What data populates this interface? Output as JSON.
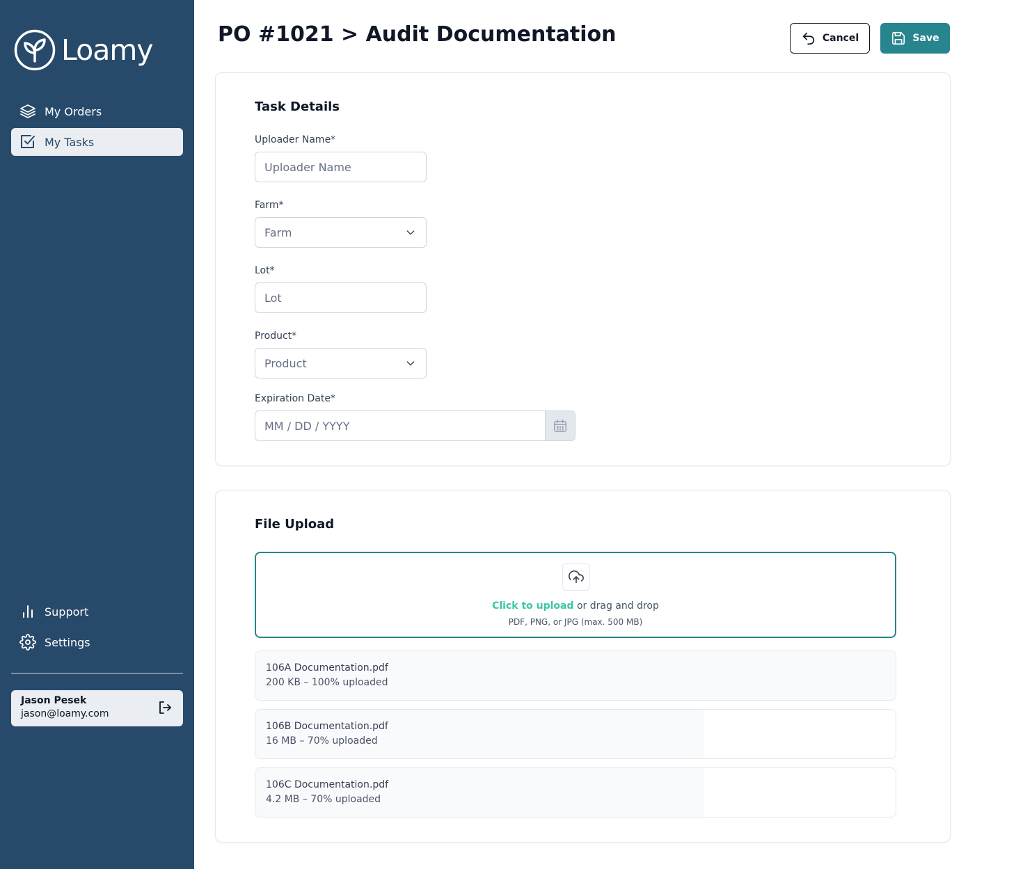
{
  "brand": {
    "name": "Loamy",
    "accent": "#26858d",
    "sidebar_bg": "#274a6b",
    "link_color": "#3cc6a7"
  },
  "sidebar": {
    "top_items": [
      {
        "label": "My Orders",
        "icon": "layers-icon",
        "active": false
      },
      {
        "label": "My Tasks",
        "icon": "check-square-icon",
        "active": true
      }
    ],
    "bottom_items": [
      {
        "label": "Support",
        "icon": "bar-chart-icon"
      },
      {
        "label": "Settings",
        "icon": "gear-icon"
      }
    ],
    "user": {
      "name": "Jason Pesek",
      "email": "jason@loamy.com"
    }
  },
  "header": {
    "title": "PO #1021 > Audit Documentation",
    "cancel_label": "Cancel",
    "save_label": "Save"
  },
  "task_details": {
    "title": "Task Details",
    "uploader": {
      "label": "Uploader Name*",
      "placeholder": "Uploader Name",
      "value": ""
    },
    "farm": {
      "label": "Farm*",
      "placeholder": "Farm"
    },
    "lot": {
      "label": "Lot*",
      "placeholder": "Lot",
      "value": ""
    },
    "product": {
      "label": "Product*",
      "placeholder": "Product"
    },
    "expiration": {
      "label": "Expiration Date*",
      "placeholder": "MM / DD / YYYY"
    }
  },
  "file_upload": {
    "title": "File Upload",
    "dropzone": {
      "link_text": "Click to upload",
      "rest_text": " or drag and drop",
      "hint": "PDF, PNG, or JPG (max. 500 MB)"
    },
    "files": [
      {
        "name": "106A Documentation.pdf",
        "meta": "200 KB – 100% uploaded",
        "progress": 1.0
      },
      {
        "name": "106B Documentation.pdf",
        "meta": "16 MB – 70% uploaded",
        "progress": 0.7
      },
      {
        "name": "106C Documentation.pdf",
        "meta": "4.2 MB – 70% uploaded",
        "progress": 0.7
      }
    ]
  }
}
